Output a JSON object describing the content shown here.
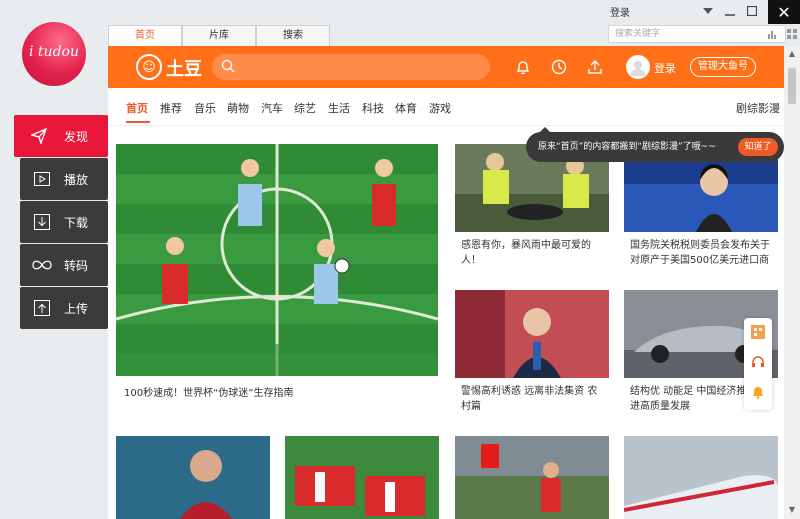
{
  "rail": {
    "logo_text": "i tudou",
    "items": [
      {
        "label": "发现",
        "icon": "paper-plane-icon",
        "active": true
      },
      {
        "label": "播放",
        "icon": "play-icon"
      },
      {
        "label": "下载",
        "icon": "download-icon"
      },
      {
        "label": "转码",
        "icon": "infinity-icon"
      },
      {
        "label": "上传",
        "icon": "upload-icon"
      }
    ]
  },
  "window": {
    "tabs": [
      "首页",
      "片库",
      "搜索"
    ],
    "login_label": "登录",
    "search_placeholder": "搜索关键字",
    "close_glyph": "✕"
  },
  "header": {
    "brand_name": "土豆",
    "login_label": "登录",
    "manage_button": "管理大鱼号"
  },
  "categories": {
    "items": [
      "首页",
      "推荐",
      "音乐",
      "萌物",
      "汽车",
      "综艺",
      "生活",
      "科技",
      "体育",
      "游戏"
    ],
    "right_label": "剧综影漫"
  },
  "tooltip": {
    "text": "原来“首页”的内容都搬到“剧综影漫”了哦~~",
    "button": "知道了"
  },
  "videos": {
    "featured_caption": "100秒速成！世界杯“伪球迷”生存指南",
    "card1_caption": "感恩有你，暴风雨中最可爱的人！",
    "card2_caption": "国务院关税税则委员会发布关于对原产于美国500亿美元进口商",
    "card3_caption": "警惕高利诱惑 远离非法集资 农村篇",
    "card4_caption": "结构优 动能足 中国经济推进高质量发展"
  },
  "colors": {
    "accent": "#fe6f17",
    "rail_active": "#e8173a",
    "rail_dark": "#3b3b3b"
  }
}
